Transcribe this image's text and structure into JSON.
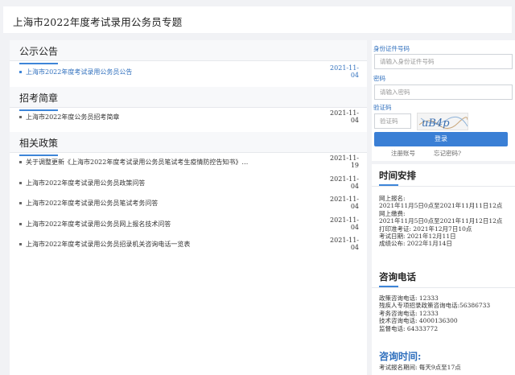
{
  "header": {
    "title": "上海市2022年度考试录用公务员专题"
  },
  "notices": {
    "title": "公示公告",
    "items": [
      {
        "text": "上海市2022年度考试录用公务员公告",
        "date": "2021-11-04"
      }
    ]
  },
  "guides": {
    "title": "招考简章",
    "items": [
      {
        "text": "上海市2022年度公务员招考简章",
        "date": "2021-11-04"
      }
    ]
  },
  "policies": {
    "title": "相关政策",
    "items": [
      {
        "text": "关于调整更新《上海市2022年度考试录用公务员笔试考生疫情防控告知书》…",
        "date": "2021-11-19"
      },
      {
        "text": "上海市2022年度考试录用公务员政策问答",
        "date": "2021-11-04"
      },
      {
        "text": "上海市2022年度考试录用公务员笔试考务问答",
        "date": "2021-11-04"
      },
      {
        "text": "上海市2022年度考试录用公务员网上报名技术问答",
        "date": "2021-11-04"
      },
      {
        "text": "上海市2022年度考试录用公务员招录机关咨询电话一览表",
        "date": "2021-11-04"
      }
    ]
  },
  "login": {
    "id_label": "身份证件号码",
    "id_placeholder": "请输入身份证件号码",
    "pwd_label": "密码",
    "pwd_placeholder": "请输入密码",
    "captcha_label": "验证码",
    "captcha_placeholder": "验证码",
    "captcha_text": "uB4p",
    "button": "登录",
    "register": "注册账号",
    "forgot": "忘记密码?"
  },
  "schedule": {
    "title": "时间安排",
    "lines": [
      "网上报名:",
      "2021年11月5日0点至2021年11月11日12点",
      "网上缴费:",
      "2021年11月5日0点至2021年11月12日12点",
      "打印准考证:  2021年12月7日10点",
      "考试日期:  2021年12月11日",
      "成绩公布:  2022年1月14日"
    ]
  },
  "phones": {
    "title": "咨询电话",
    "lines": [
      "政策咨询电话:  12333",
      "残疾人专项招录政策咨询电话:56386733",
      "考务咨询电话:  12333",
      "技术咨询电话:  4000136300",
      "监督电话:  64333772"
    ]
  },
  "consult": {
    "title": "咨询时间:",
    "line": "考试报名期间:  每天9点至17点"
  },
  "colors": {
    "accent": "#3e85d8",
    "link": "#2f6fbd",
    "bg": "#f1f2f5"
  }
}
